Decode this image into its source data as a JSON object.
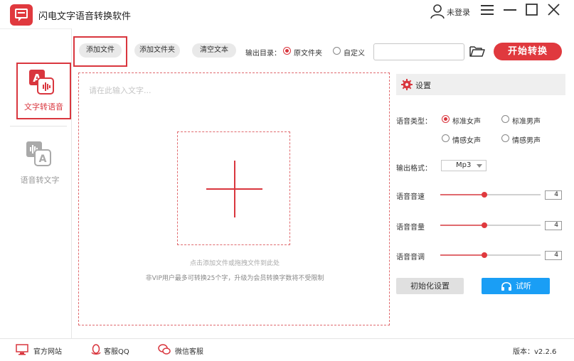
{
  "app": {
    "title": "闪电文字语音转换软件"
  },
  "header": {
    "user_label": "未登录"
  },
  "sidebar": {
    "items": [
      {
        "label": "文字转语音",
        "active": true
      },
      {
        "label": "语音转文字",
        "active": false
      }
    ]
  },
  "toolbar": {
    "add_file": "添加文件",
    "add_folder": "添加文件夹",
    "clear_text": "清空文本",
    "output_dir_label": "输出目录：",
    "output_options": [
      {
        "label": "原文件夹",
        "checked": true
      },
      {
        "label": "自定义",
        "checked": false
      }
    ],
    "output_path": "",
    "start": "开始转换"
  },
  "editor": {
    "placeholder": "请在此输入文字...",
    "drop_hint": "点击添加文件或拖拽文件到此处",
    "vip_hint": "非VIP用户最多可转换25个字，升级为会员转换字数将不受限制"
  },
  "settings": {
    "title": "设置",
    "voice_type_label": "语音类型：",
    "voice_types": [
      {
        "label": "标准女声",
        "checked": true
      },
      {
        "label": "标准男声",
        "checked": false
      },
      {
        "label": "情感女声",
        "checked": false
      },
      {
        "label": "情感男声",
        "checked": false
      }
    ],
    "format_label": "输出格式：",
    "format_value": "Mp3",
    "sliders": [
      {
        "label": "语音音速",
        "value": "4",
        "fraction": 0.44
      },
      {
        "label": "语音音量",
        "value": "4",
        "fraction": 0.44
      },
      {
        "label": "语音音调",
        "value": "4",
        "fraction": 0.44
      }
    ],
    "init_button": "初始化设置",
    "listen_button": "试听"
  },
  "footer": {
    "website": "官方网站",
    "qq": "客服QQ",
    "wechat": "微信客服",
    "version": "版本：v2.2.6"
  },
  "colors": {
    "accent": "#e0393e",
    "listen": "#1a9ef5"
  }
}
